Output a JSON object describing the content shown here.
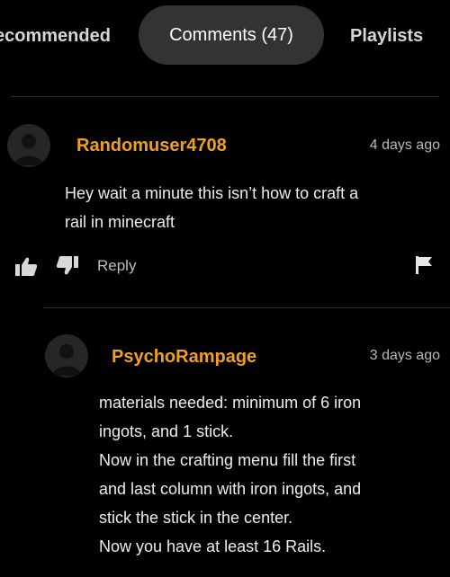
{
  "tabs": {
    "recommended": "ecommended",
    "comments": "Comments (47)",
    "playlists": "Playlists"
  },
  "comment": {
    "username": "Randomuser4708",
    "timestamp": "4 days ago",
    "lines": [
      "Hey wait a minute this isn’t how to craft a",
      "rail in minecraft"
    ],
    "reply_label": "Reply"
  },
  "reply": {
    "username": "PsychoRampage",
    "timestamp": "3 days ago",
    "lines": [
      "materials needed: minimum of 6 iron",
      "ingots, and 1 stick.",
      "Now in the crafting menu fill the first",
      "and last column with iron ingots, and",
      "stick the stick in the center.",
      "Now you have at least 16 Rails."
    ]
  },
  "colors": {
    "background": "#000000",
    "username": "#f0a020",
    "active_tab": "#333333"
  },
  "icons": [
    "like-icon",
    "dislike-icon",
    "flag-icon",
    "avatar-icon"
  ]
}
